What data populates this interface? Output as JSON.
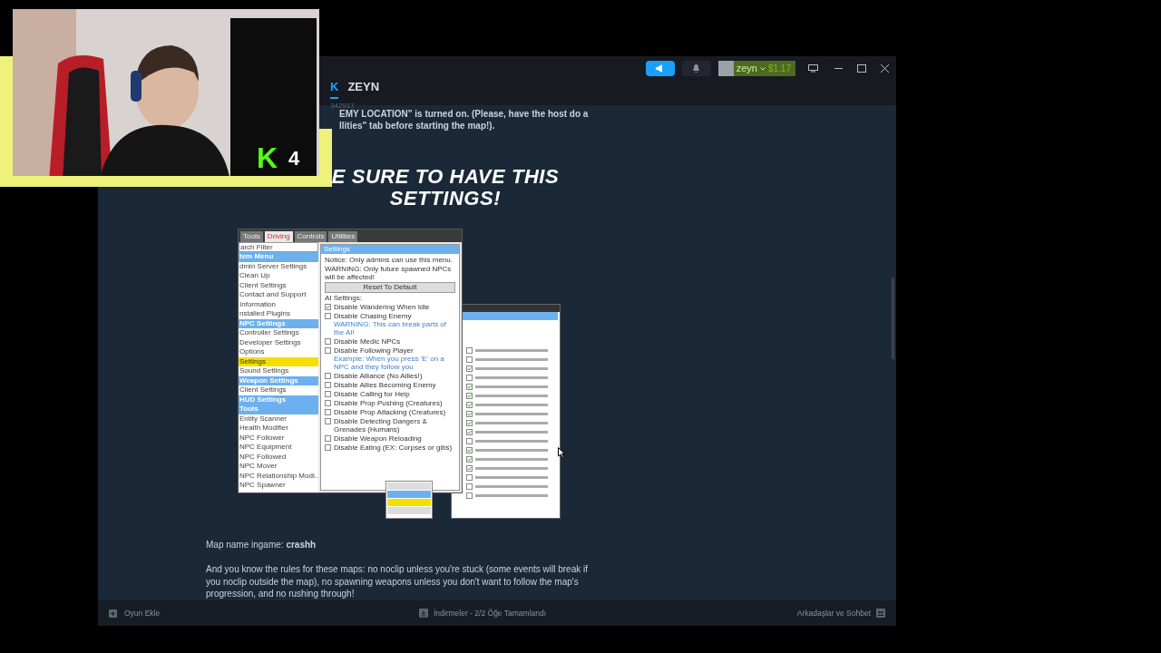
{
  "overlay": {
    "badge_letter": "K",
    "badge_count": "4"
  },
  "header": {
    "tabs": [
      {
        "label": "K",
        "selected": true
      },
      {
        "label": "ZEYN",
        "selected": false
      }
    ],
    "user": {
      "name": "zeyn",
      "balance": "$1.17"
    },
    "id_text": "342917"
  },
  "description": {
    "lines": [
      "EMY LOCATION\" is turned on. (Please, have the host do a",
      "llities\" tab before starting the map!)."
    ],
    "heading": [
      "E SURE TO HAVE THIS",
      "SETTINGS!"
    ],
    "map_name": "Map name ingame: **crashh**",
    "rules": "And you know the rules for these maps: no noclip unless you're stuck (some events will break if you noclip outside the map), no spawning weapons unless you don't want to follow the map's progression, and no rushing through!"
  },
  "screenshot": {
    "tabs": [
      {
        "label": "Tools",
        "selected": false
      },
      {
        "label": "Driving",
        "selected": true
      },
      {
        "label": "Controls",
        "selected": false
      },
      {
        "label": "Utilities",
        "selected": false
      }
    ],
    "filter_placeholder": "arch Filter",
    "menu": [
      {
        "label": "tem Menu",
        "kind": "header"
      },
      {
        "label": "dmin Server Settings",
        "kind": "item"
      },
      {
        "label": "Clean Up",
        "kind": "item"
      },
      {
        "label": "Client Settings",
        "kind": "item"
      },
      {
        "label": "Contact and Support",
        "kind": "item"
      },
      {
        "label": "Information",
        "kind": "item"
      },
      {
        "label": "nstalled Plugins",
        "kind": "item"
      },
      {
        "label": "NPC Settings",
        "kind": "header"
      },
      {
        "label": "Controller Settings",
        "kind": "item"
      },
      {
        "label": "Developer Settings",
        "kind": "item"
      },
      {
        "label": "Options",
        "kind": "item"
      },
      {
        "label": "Settings",
        "kind": "highlight"
      },
      {
        "label": "Sound Settings",
        "kind": "item"
      },
      {
        "label": "Weapon Settings",
        "kind": "header"
      },
      {
        "label": "Client Settings",
        "kind": "item"
      },
      {
        "label": "HUD Settings",
        "kind": "header"
      },
      {
        "label": "Tools",
        "kind": "header"
      },
      {
        "label": "Entity Scanner",
        "kind": "item"
      },
      {
        "label": "Health Modifier",
        "kind": "item"
      },
      {
        "label": "NPC Follower",
        "kind": "item"
      },
      {
        "label": "NPC Equipment",
        "kind": "item"
      },
      {
        "label": "NPC Followed",
        "kind": "item"
      },
      {
        "label": "NPC Mover",
        "kind": "item"
      },
      {
        "label": "NPC Relationship Modi..",
        "kind": "item"
      },
      {
        "label": "NPC Spawner",
        "kind": "item"
      }
    ],
    "panel_title": "Settings",
    "notice": "Notice: Only admins can use this menu.",
    "warning": "WARNING: Only future spawned NPCs will be affected!",
    "reset_button": "Reset To Default",
    "section": "AI Settings:",
    "options": [
      {
        "label": "Disable Wandering When Idle",
        "checked": true
      },
      {
        "label": "Disable Chasing Enemy",
        "checked": false,
        "note": "WARNING: This can break parts of the AI!"
      },
      {
        "label": "Disable Medic NPCs",
        "checked": false
      },
      {
        "label": "Disable Following Player",
        "checked": false,
        "note": "Example: When you press 'E' on a NPC and they follow you"
      },
      {
        "label": "Disable Alliance (No Allies!)",
        "checked": false
      },
      {
        "label": "Disable Allies Becoming Enemy",
        "checked": false
      },
      {
        "label": "Disable Calling for Help",
        "checked": false
      },
      {
        "label": "Disable Prop Pushing (Creatures)",
        "checked": false
      },
      {
        "label": "Disable Prop Attacking (Creatures)",
        "checked": false
      },
      {
        "label": "Disable Detecting Dangers & Grenades (Humans)",
        "checked": false
      },
      {
        "label": "Disable Weapon Reloading",
        "checked": false
      },
      {
        "label": "Disable Eating (EX: Corpses or gibs)",
        "checked": false
      }
    ],
    "second_options": [
      {
        "checked": false
      },
      {
        "checked": false
      },
      {
        "checked": true
      },
      {
        "checked": false
      },
      {
        "checked": true
      },
      {
        "checked": true
      },
      {
        "checked": true
      },
      {
        "checked": true
      },
      {
        "checked": true
      },
      {
        "checked": true
      },
      {
        "checked": false
      },
      {
        "checked": true
      },
      {
        "checked": true
      },
      {
        "checked": true
      },
      {
        "checked": false
      },
      {
        "checked": false
      },
      {
        "checked": false
      }
    ],
    "dropdown": [
      {
        "kind": "item"
      },
      {
        "kind": "header"
      },
      {
        "kind": "highlight"
      },
      {
        "kind": "item"
      }
    ]
  },
  "status_bar": {
    "add_game": "Oyun Ekle",
    "downloads": "İndirmeler - 2/2 Öğe Tamamlandı",
    "friends": "Arkadaşlar ve Sohbet"
  }
}
